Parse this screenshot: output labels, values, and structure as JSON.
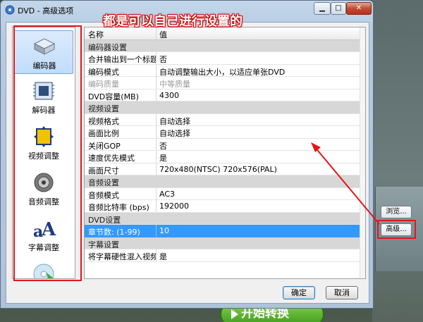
{
  "window": {
    "title": "DVD - 高级选项"
  },
  "annotation": "都是可以自己进行设置的",
  "nav": {
    "items": [
      {
        "label": "编码器",
        "icon": "disk-drive-icon"
      },
      {
        "label": "解码器",
        "icon": "circuit-board-icon"
      },
      {
        "label": "视频调整",
        "icon": "crop-frame-icon"
      },
      {
        "label": "音频调整",
        "icon": "speaker-icon"
      },
      {
        "label": "字幕调整",
        "icon": "font-letters-icon"
      },
      {
        "label": "",
        "icon": "disc-icon"
      }
    ]
  },
  "grid": {
    "header": {
      "name": "名称",
      "value": "值"
    },
    "rows": [
      {
        "type": "section",
        "name": "编码器设置",
        "value": ""
      },
      {
        "type": "item",
        "name": "合并输出到一个标题",
        "value": "否"
      },
      {
        "type": "item",
        "name": "编码模式",
        "value": "自动调整输出大小，以适应单张DVD"
      },
      {
        "type": "disabled",
        "name": "编码质量",
        "value": "中等质量"
      },
      {
        "type": "item",
        "name": "DVD容量(MB)",
        "value": "4300"
      },
      {
        "type": "section",
        "name": "视频设置",
        "value": ""
      },
      {
        "type": "item",
        "name": "视频格式",
        "value": "自动选择"
      },
      {
        "type": "item",
        "name": "画面比例",
        "value": "自动选择"
      },
      {
        "type": "item",
        "name": "关闭GOP",
        "value": "否"
      },
      {
        "type": "item",
        "name": "速度优先模式",
        "value": "是"
      },
      {
        "type": "item",
        "name": "画面尺寸",
        "value": "720x480(NTSC) 720x576(PAL)"
      },
      {
        "type": "section",
        "name": "音频设置",
        "value": ""
      },
      {
        "type": "item",
        "name": "音频模式",
        "value": "AC3"
      },
      {
        "type": "item",
        "name": "音频比特率 (bps)",
        "value": "192000"
      },
      {
        "type": "section",
        "name": "DVD设置",
        "value": ""
      },
      {
        "type": "selected",
        "name": "章节数: (1-99)",
        "value": "10"
      },
      {
        "type": "section",
        "name": "字幕设置",
        "value": ""
      },
      {
        "type": "item",
        "name": "将字幕硬性混入视频...",
        "value": "是"
      }
    ]
  },
  "buttons": {
    "ok": "确定",
    "cancel": "取消"
  },
  "background": {
    "browse": "浏览...",
    "advanced": "高级...",
    "start": "开始转换"
  },
  "colors": {
    "annotation_red": "#e3161c",
    "selected_row": "#3399ff"
  }
}
